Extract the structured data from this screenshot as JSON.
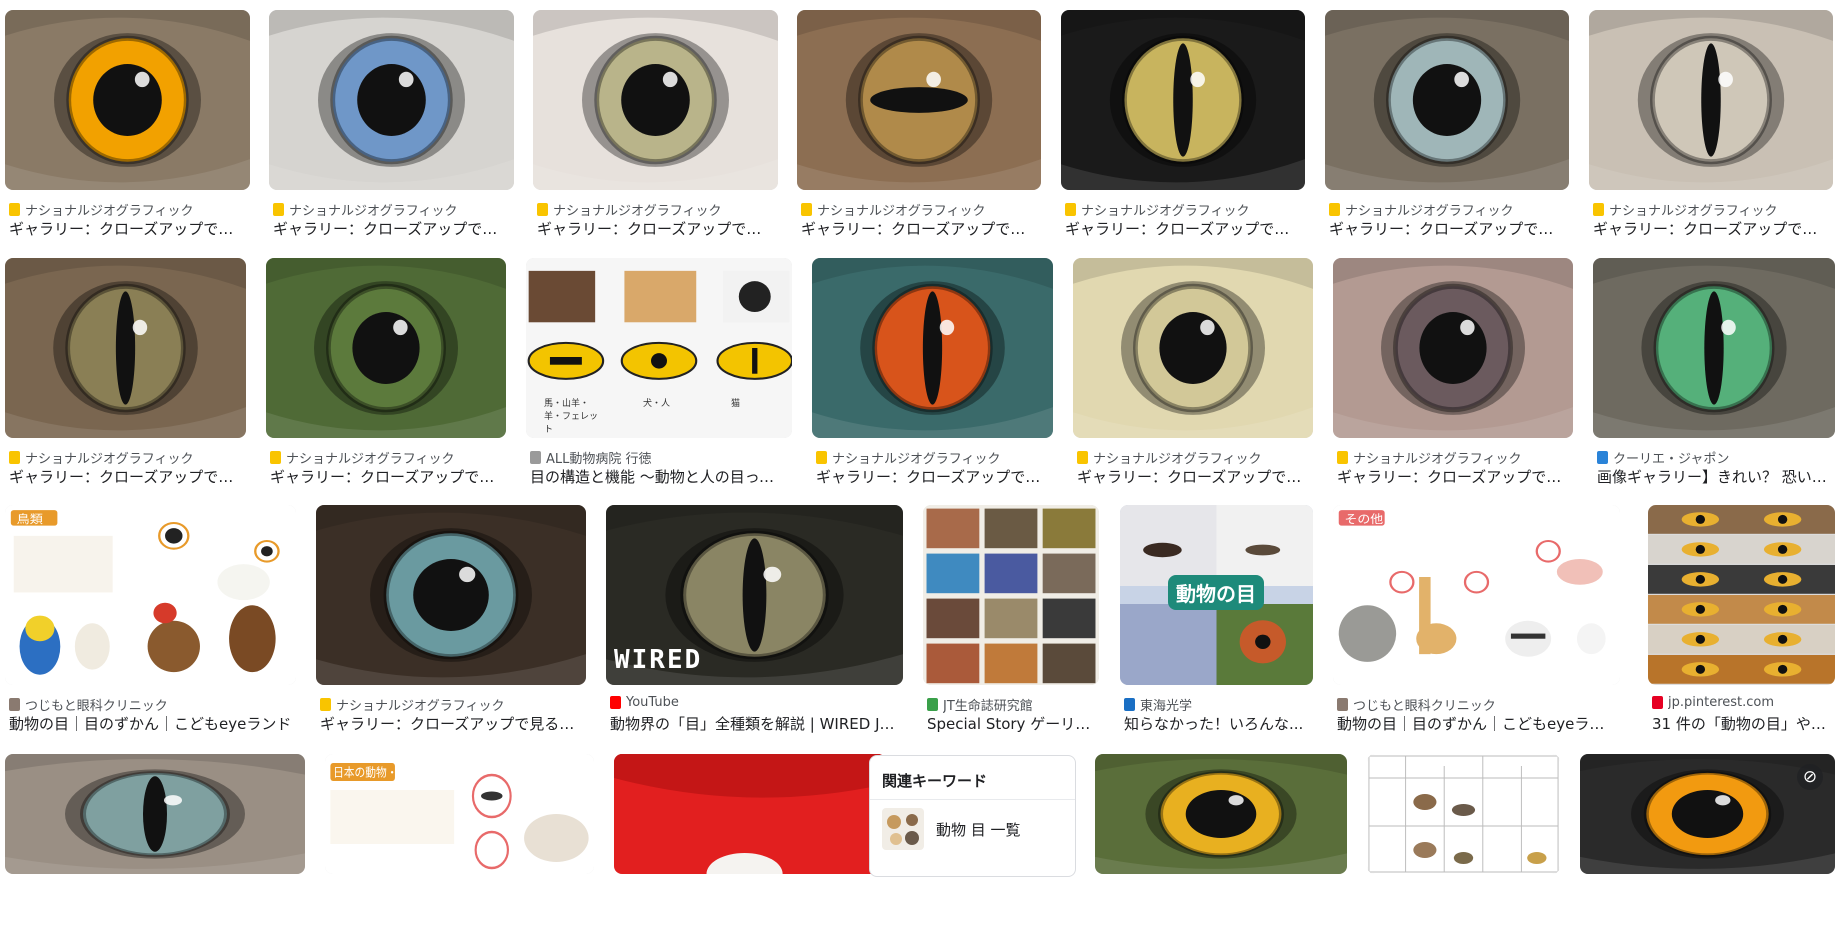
{
  "row1": [
    {
      "source": "ナショナルジオグラフィック",
      "title": "ギャラリー：クローズアップで見...",
      "fav": "#f9c400",
      "iris": "#f2a100",
      "bg": "#8a7a66",
      "pupil": "round"
    },
    {
      "source": "ナショナルジオグラフィック",
      "title": "ギャラリー：クローズアップで見...",
      "fav": "#f9c400",
      "iris": "#6f97c8",
      "bg": "#d6d4d0",
      "pupil": "round"
    },
    {
      "source": "ナショナルジオグラフィック",
      "title": "ギャラリー：クローズアップで見...",
      "fav": "#f9c400",
      "iris": "#b9b48a",
      "bg": "#e7e1dc",
      "pupil": "round"
    },
    {
      "source": "ナショナルジオグラフィック",
      "title": "ギャラリー：クローズアップで見...",
      "fav": "#f9c400",
      "iris": "#b08a4a",
      "bg": "#8c6e52",
      "pupil": "wide"
    },
    {
      "source": "ナショナルジオグラフィック",
      "title": "ギャラリー：クローズアップで見...",
      "fav": "#f9c400",
      "iris": "#c8b45e",
      "bg": "#1a1a1a",
      "pupil": "slit"
    },
    {
      "source": "ナショナルジオグラフィック",
      "title": "ギャラリー：クローズアップで見...",
      "fav": "#f9c400",
      "iris": "#9fb6b8",
      "bg": "#7a7062",
      "pupil": "round"
    },
    {
      "source": "ナショナルジオグラフィック",
      "title": "ギャラリー：クローズアップで見...",
      "fav": "#f9c400",
      "iris": "#cfc7b8",
      "bg": "#c9c0b4",
      "pupil": "slit"
    }
  ],
  "row2": [
    {
      "source": "ナショナルジオグラフィック",
      "title": "ギャラリー：クローズアップで見...",
      "fav": "#f9c400",
      "iris": "#8a7f55",
      "bg": "#7a6650",
      "pupil": "slit"
    },
    {
      "source": "ナショナルジオグラフィック",
      "title": "ギャラリー：クローズアップで見...",
      "fav": "#f9c400",
      "iris": "#5c7a3c",
      "bg": "#4f6a36",
      "pupil": "round"
    },
    {
      "source": "ALL動物病院 行徳",
      "title": "目の構造と機能 ～動物と人の目って...",
      "fav": "#9a9a9a",
      "iris": "#f3c400",
      "bg": "#f4f4f4",
      "pupil": "diagram",
      "labels": [
        "馬・山羊・羊・フェレット",
        "犬・人",
        "猫"
      ]
    },
    {
      "source": "ナショナルジオグラフィック",
      "title": "ギャラリー：クローズアップで見...",
      "fav": "#f9c400",
      "iris": "#d8541b",
      "bg": "#3a6a6a",
      "pupil": "slit"
    },
    {
      "source": "ナショナルジオグラフィック",
      "title": "ギャラリー：クローズアップで見...",
      "fav": "#f9c400",
      "iris": "#d2c898",
      "bg": "#e1d8b0",
      "pupil": "round"
    },
    {
      "source": "ナショナルジオグラフィック",
      "title": "ギャラリー：クローズアップで見...",
      "fav": "#f9c400",
      "iris": "#6b5a5e",
      "bg": "#b39a92",
      "pupil": "round"
    },
    {
      "source": "クーリエ・ジャポン",
      "title": "画像ギャラリー】きれい？ 恐い？...",
      "fav": "#2a83d8",
      "iris": "#55b07a",
      "bg": "#6e6a60",
      "pupil": "slit"
    }
  ],
  "row3": [
    {
      "source": "つじもと眼科クリニック",
      "title": "動物の目｜目のずかん｜こどもeyeランド",
      "fav": "#8a7a70",
      "bg": "#ffffff",
      "kind": "birds",
      "header": "鳥類"
    },
    {
      "source": "ナショナルジオグラフィック",
      "title": "ギャラリー：クローズアップで見る動...",
      "fav": "#f9c400",
      "iris": "#6a9aa0",
      "bg": "#3b2f26",
      "pupil": "round"
    },
    {
      "source": "YouTube",
      "title": "動物界の「目」全種類を解説 | WIRED Jap...",
      "fav": "#ff0000",
      "iris": "#8a8564",
      "bg": "#2a2a24",
      "pupil": "slit",
      "overlay": "WIRED"
    },
    {
      "source": "JT生命誌研究館",
      "title": "Special Story ゲーリン...",
      "fav": "#3aa04a",
      "bg": "#f0ede6",
      "kind": "grid"
    },
    {
      "source": "東海光学",
      "title": "知らなかった！いろんな...",
      "fav": "#1a6fc4",
      "bg": "#b7c6de",
      "kind": "collage",
      "overlay": "動物の目"
    },
    {
      "source": "つじもと眼科クリニック",
      "title": "動物の目｜目のずかん｜こどもeyeランド",
      "fav": "#8a7a70",
      "bg": "#ffffff",
      "kind": "mammals",
      "header": "その他"
    },
    {
      "source": "jp.pinterest.com",
      "title": "31 件の「動物の目」や「...",
      "fav": "#e60023",
      "bg": "#cfc7bb",
      "kind": "strips"
    }
  ],
  "row4": [
    {
      "iris": "#7fa0a0",
      "bg": "#9a8f84",
      "pupil": "slit"
    },
    {
      "bg": "#ffffff",
      "kind": "sheep",
      "header": "日本の動物・ウシ科"
    },
    {
      "bg": "#e21f1f",
      "kind": "parrot"
    },
    {
      "bg": "#ffffff",
      "kind": "related"
    },
    {
      "iris": "#e8b020",
      "bg": "#5a6e3a",
      "pupil": "round"
    },
    {
      "bg": "#ffffff",
      "kind": "table"
    },
    {
      "iris": "#f29a10",
      "bg": "#2a2a2a",
      "pupil": "round",
      "badge": "⊘"
    }
  ],
  "related": {
    "heading": "関連キーワード",
    "item": "動物 目 一覧"
  },
  "colors": {
    "text": "#202124",
    "muted": "#4d5156",
    "border": "#dadce0"
  }
}
